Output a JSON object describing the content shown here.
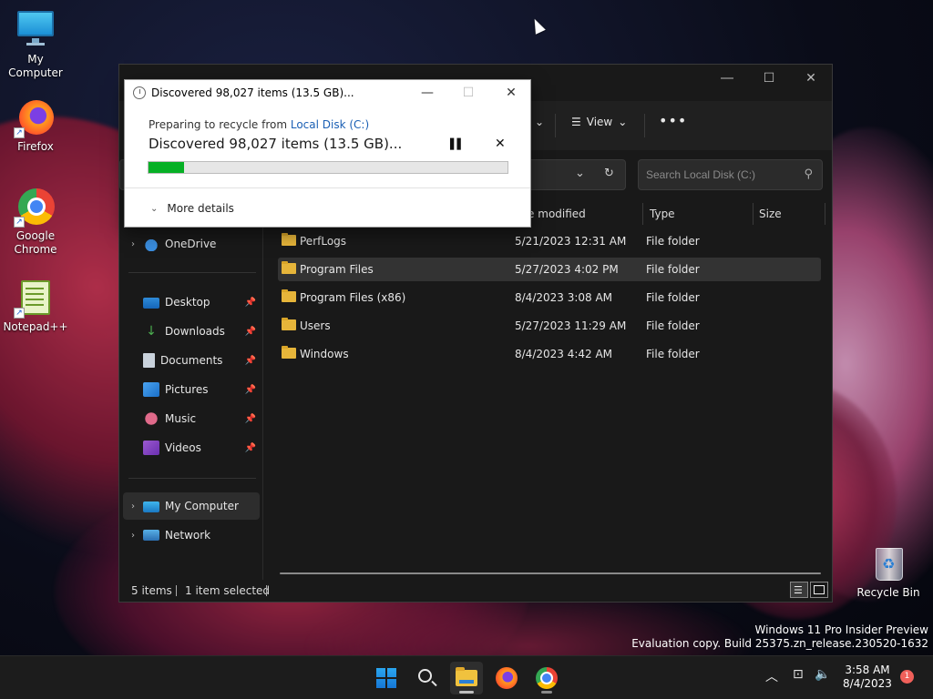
{
  "desktop": {
    "icons": [
      {
        "label": "My Computer",
        "icon": "monitor-icon"
      },
      {
        "label": "Firefox",
        "icon": "firefox-icon"
      },
      {
        "label": "Google Chrome",
        "icon": "chrome-icon"
      },
      {
        "label": "Notepad++",
        "icon": "notepad-plus-plus-icon"
      },
      {
        "label": "Recycle Bin",
        "icon": "recycle-bin-icon"
      }
    ],
    "watermark": {
      "line1": "Windows 11 Pro Insider Preview",
      "line2": "Evaluation copy. Build 25375.zn_release.230520-1632"
    }
  },
  "dialog": {
    "title": "Discovered 98,027 items (13.5 GB)...",
    "subtitle_prefix": "Preparing to recycle from ",
    "subtitle_link": "Local Disk (C:)",
    "status": "Discovered 98,027 items (13.5 GB)...",
    "progress_fraction": 0.1,
    "more_details": "More details",
    "progress_color": "#06b025"
  },
  "explorer": {
    "toolbar": {
      "view_label": "View"
    },
    "search": {
      "placeholder": "Search Local Disk (C:)"
    },
    "columns": {
      "date_modified": "ate modified",
      "type": "Type",
      "size": "Size"
    },
    "nav": {
      "onedrive": "OneDrive",
      "quick_access": [
        {
          "label": "Desktop",
          "icon": "desktop-icon"
        },
        {
          "label": "Downloads",
          "icon": "downloads-icon"
        },
        {
          "label": "Documents",
          "icon": "documents-icon"
        },
        {
          "label": "Pictures",
          "icon": "pictures-icon"
        },
        {
          "label": "Music",
          "icon": "music-icon"
        },
        {
          "label": "Videos",
          "icon": "videos-icon"
        }
      ],
      "my_computer": "My Computer",
      "network": "Network"
    },
    "rows": [
      {
        "name": "PerfLogs",
        "date": "5/21/2023 12:31 AM",
        "type": "File folder"
      },
      {
        "name": "Program Files",
        "date": "5/27/2023 4:02 PM",
        "type": "File folder"
      },
      {
        "name": "Program Files (x86)",
        "date": "8/4/2023 3:08 AM",
        "type": "File folder"
      },
      {
        "name": "Users",
        "date": "5/27/2023 11:29 AM",
        "type": "File folder"
      },
      {
        "name": "Windows",
        "date": "8/4/2023 4:42 AM",
        "type": "File folder"
      }
    ],
    "status": {
      "items": "5 items",
      "selected": "1 item selected"
    }
  },
  "taskbar": {
    "time": "3:58 AM",
    "date": "8/4/2023",
    "notification_count": "1",
    "accent": "#1677d6"
  }
}
